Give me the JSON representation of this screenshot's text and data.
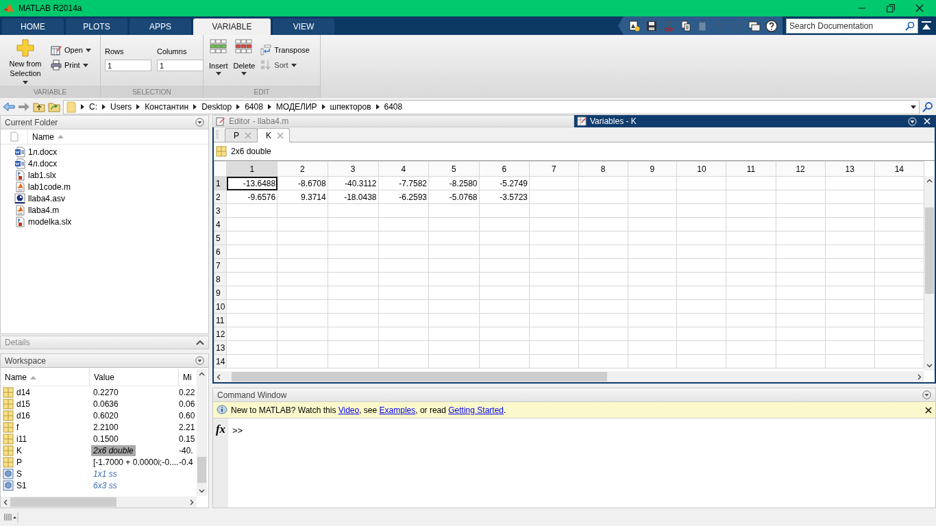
{
  "window": {
    "title": "MATLAB R2014a"
  },
  "ribbon": {
    "tabs": [
      {
        "label": "HOME",
        "selected": false
      },
      {
        "label": "PLOTS",
        "selected": false
      },
      {
        "label": "APPS",
        "selected": false
      },
      {
        "label": "VARIABLE",
        "selected": true
      },
      {
        "label": "VIEW",
        "selected": false
      }
    ],
    "quick_access": [
      {
        "kind": "new",
        "disabled": false
      },
      {
        "kind": "save",
        "disabled": false
      },
      {
        "kind": "cut",
        "disabled": false
      },
      {
        "kind": "copy",
        "disabled": false
      },
      {
        "kind": "paste",
        "disabled": true
      },
      {
        "kind": "undo",
        "disabled": true
      },
      {
        "kind": "redo",
        "disabled": true
      },
      {
        "kind": "windows",
        "disabled": false
      },
      {
        "kind": "help",
        "disabled": false
      }
    ],
    "search": {
      "placeholder": "Search Documentation"
    },
    "variable_group": {
      "title": "VARIABLE",
      "new_from_selection": {
        "label": "New from Selection",
        "menu": true
      },
      "open": {
        "label": "Open",
        "menu": true
      },
      "print": {
        "label": "Print",
        "menu": true
      }
    },
    "selection_group": {
      "title": "SELECTION",
      "rows": {
        "label": "Rows",
        "value": "1"
      },
      "columns": {
        "label": "Columns",
        "value": "1"
      }
    },
    "edit_group": {
      "title": "EDIT",
      "insert": {
        "label": "Insert",
        "menu": true
      },
      "delete": {
        "label": "Delete",
        "menu": true
      },
      "transpose": {
        "label": "Transpose",
        "disabled": false
      },
      "sort": {
        "label": "Sort",
        "menu": true,
        "disabled": true
      }
    }
  },
  "address_bar": {
    "path": [
      "C:",
      "Users",
      "Константин",
      "Desktop",
      "6408",
      "МОДЕЛИР",
      "шпекторов",
      "6408"
    ]
  },
  "current_folder": {
    "title": "Current Folder",
    "column": "Name",
    "files": [
      {
        "name": "1л.docx",
        "kind": "word"
      },
      {
        "name": "4л.docx",
        "kind": "word"
      },
      {
        "name": "lab1.slx",
        "kind": "model"
      },
      {
        "name": "lab1code.m",
        "kind": "script"
      },
      {
        "name": "llaba4.asv",
        "kind": "autosave"
      },
      {
        "name": "llaba4.m",
        "kind": "script"
      },
      {
        "name": "modelka.slx",
        "kind": "model"
      }
    ]
  },
  "details": {
    "title": "Details"
  },
  "workspace": {
    "title": "Workspace",
    "columns": [
      "Name",
      "Value",
      "Mi"
    ],
    "rows": [
      {
        "name": "d14",
        "value": "0.2270",
        "min": "0.22",
        "kind": "matrix",
        "selected": false
      },
      {
        "name": "d15",
        "value": "0.0636",
        "min": "0.06",
        "kind": "matrix",
        "selected": false
      },
      {
        "name": "d16",
        "value": "0.6020",
        "min": "0.60",
        "kind": "matrix",
        "selected": false
      },
      {
        "name": "f",
        "value": "2.2100",
        "min": "2.21",
        "kind": "matrix",
        "selected": false
      },
      {
        "name": "i11",
        "value": "0.1500",
        "min": "0.15",
        "kind": "matrix",
        "selected": false
      },
      {
        "name": "K",
        "value": "2x6 double",
        "min": "-40.",
        "kind": "matrix",
        "selected": true
      },
      {
        "name": "P",
        "value": "[-1.7000 + 0.0000i;-0....",
        "min": "-0.4",
        "kind": "matrix",
        "selected": false
      },
      {
        "name": "S",
        "value": "1x1 ss",
        "kind": "struct",
        "selected": false
      },
      {
        "name": "S1",
        "value": "6x3 ss",
        "kind": "struct",
        "selected": false
      }
    ]
  },
  "editor": {
    "title": "Editor - llaba4.m"
  },
  "variables": {
    "title": "Variables - K",
    "tabs": [
      {
        "label": "P",
        "selected": false
      },
      {
        "label": "K",
        "selected": true
      }
    ],
    "info": "2x6 double",
    "grid": {
      "columns": [
        {
          "label": "1",
          "selected": true
        },
        {
          "label": "2",
          "selected": false
        },
        {
          "label": "3",
          "selected": false
        },
        {
          "label": "4",
          "selected": false
        },
        {
          "label": "5",
          "selected": false
        },
        {
          "label": "6",
          "selected": false
        },
        {
          "label": "7",
          "selected": false
        },
        {
          "label": "8",
          "selected": false
        },
        {
          "label": "9",
          "selected": false
        },
        {
          "label": "10",
          "selected": false
        },
        {
          "label": "11",
          "selected": false
        },
        {
          "label": "12",
          "selected": false
        },
        {
          "label": "13",
          "selected": false
        },
        {
          "label": "14",
          "selected": false
        }
      ],
      "rows": [
        {
          "header": "1",
          "selected": true,
          "cells": [
            "-13.6488",
            "-8.6708",
            "-40.3112",
            "-7.7582",
            "-8.2580",
            "-5.2749"
          ]
        },
        {
          "header": "2",
          "selected": false,
          "cells": [
            "-9.6576",
            "9.3714",
            "-18.0438",
            "-6.2593",
            "-5.0768",
            "-3.5723"
          ]
        },
        {
          "header": "3",
          "selected": false
        },
        {
          "header": "4",
          "selected": false
        },
        {
          "header": "5",
          "selected": false
        },
        {
          "header": "6",
          "selected": false
        },
        {
          "header": "7",
          "selected": false
        },
        {
          "header": "8",
          "selected": false
        },
        {
          "header": "9",
          "selected": false
        },
        {
          "header": "10",
          "selected": false
        },
        {
          "header": "11",
          "selected": false
        },
        {
          "header": "12",
          "selected": false
        },
        {
          "header": "13",
          "selected": false
        },
        {
          "header": "14",
          "selected": false
        }
      ]
    }
  },
  "command_window": {
    "title": "Command Window",
    "banner": [
      {
        "text": "New to MATLAB? Watch this ",
        "link": false
      },
      {
        "text": "Video",
        "link": true
      },
      {
        "text": ", see ",
        "link": false
      },
      {
        "text": "Examples",
        "link": true
      },
      {
        "text": ", or read ",
        "link": false
      },
      {
        "text": "Getting Started",
        "link": true
      },
      {
        "text": ".",
        "link": false
      }
    ],
    "function_button": "fx",
    "prompt": ">>"
  }
}
